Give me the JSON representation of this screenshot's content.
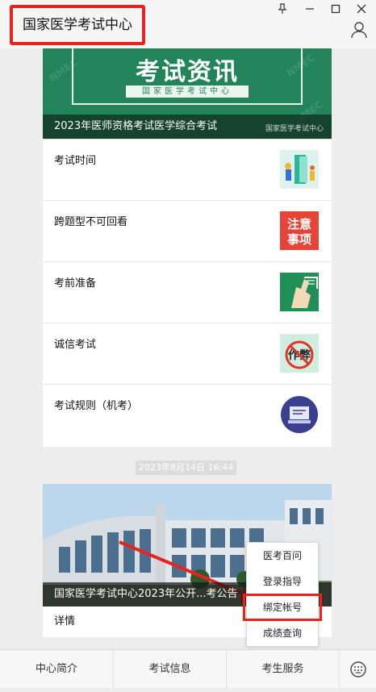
{
  "window": {
    "title": "国家医学考试中心",
    "controls": [
      "pin-icon",
      "minimize-icon",
      "maximize-icon",
      "close-icon"
    ],
    "profile_icon": "user-icon"
  },
  "article_card": {
    "banner_title": "考试资讯",
    "banner_subtitle": "国家医学考试中心",
    "watermark": "NMEC",
    "caption": "2023年医师资格考试医学综合考试",
    "source": "国家医学考试中心",
    "items": [
      {
        "title": "考试时间",
        "thumb": "exam-time-illustration"
      },
      {
        "title": "跨题型不可回看",
        "thumb": "notice-badge",
        "thumb_text": "注意事项"
      },
      {
        "title": "考前准备",
        "thumb": "hand-note-illustration"
      },
      {
        "title": "诚信考试",
        "thumb": "no-cheating-sign",
        "thumb_text": "作弊"
      },
      {
        "title": "考试规则（机考）",
        "thumb": "computer-exam-illustration"
      }
    ]
  },
  "timestamp": "2023年8月14日 16:44",
  "news_card": {
    "caption": "国家医学考试中心2023年公开...考公告",
    "detail_label": "详情"
  },
  "menu": {
    "items": [
      "医考百问",
      "登录指导",
      "绑定帐号",
      "成绩查询"
    ],
    "highlighted_index": 2
  },
  "tabbar": {
    "tabs": [
      "中心简介",
      "考试信息",
      "考生服务"
    ],
    "keyboard_icon": "keyboard-icon"
  },
  "colors": {
    "accent_red": "#e8231d",
    "banner_green": "#23845a"
  }
}
